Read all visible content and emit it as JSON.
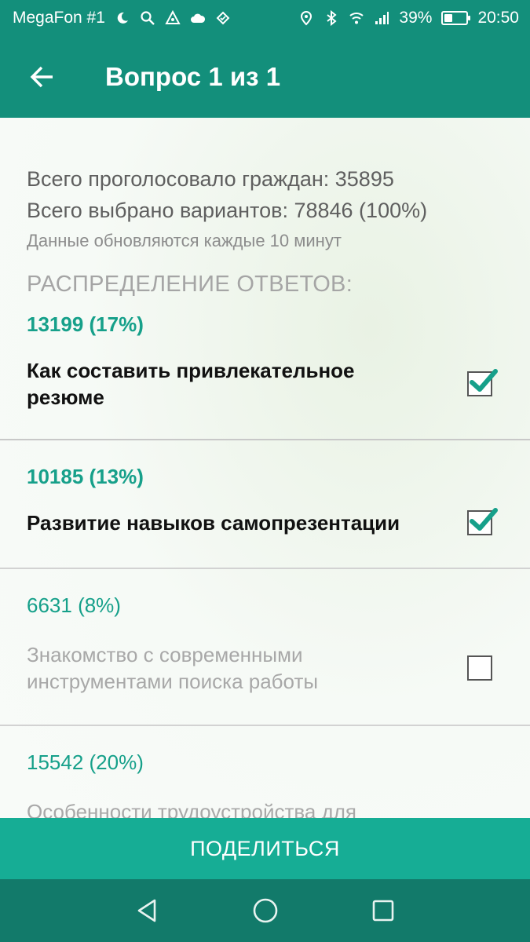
{
  "status_bar": {
    "carrier": "MegaFon #1",
    "battery": "39%",
    "battery_level": 0.39,
    "time": "20:50",
    "left_icons": [
      "moon-icon",
      "search-icon",
      "triangle-icon",
      "cloud-icon",
      "diamond-icon"
    ],
    "right_icons": [
      "location-icon",
      "bluetooth-icon",
      "wifi-icon",
      "signal-icon",
      "battery-icon"
    ]
  },
  "app_bar": {
    "title": "Вопрос 1 из 1",
    "back_icon": "arrow-left-icon"
  },
  "summary": {
    "voted_citizens": "Всего проголосовало граждан: 35895",
    "selected_options": "Всего выбрано вариантов: 78846 (100%)",
    "update_note": "Данные обновляются каждые 10 минут",
    "distribution_title": "РАСПРЕДЕЛЕНИЕ ОТВЕТОВ:"
  },
  "answers": [
    {
      "count": "13199 (17%)",
      "label": "Как составить привлекательное резюме",
      "checked": true
    },
    {
      "count": "10185 (13%)",
      "label": "Развитие навыков самопрезентации",
      "checked": true
    },
    {
      "count": "6631 (8%)",
      "label": "Знакомство с современными инструментами поиска работы",
      "checked": false
    },
    {
      "count": "15542 (20%)",
      "label": "Особенности трудоустройства для",
      "checked": false
    }
  ],
  "share_button": {
    "label": "ПОДЕЛИТЬСЯ"
  },
  "nav_bar": {
    "buttons": [
      "back-triangle-icon",
      "home-circle-icon",
      "recents-square-icon"
    ]
  },
  "colors": {
    "primary": "#138f7b",
    "accent": "#16a08a",
    "button": "#16ad95",
    "nav": "#127a6a"
  }
}
